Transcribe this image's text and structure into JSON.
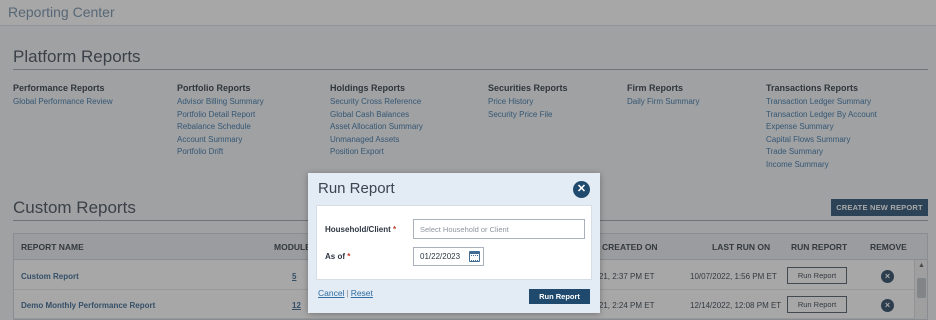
{
  "app": {
    "title": "Reporting Center"
  },
  "platform_reports": {
    "title": "Platform Reports",
    "columns": [
      {
        "heading": "Performance Reports",
        "links": [
          "Global Performance Review"
        ]
      },
      {
        "heading": "Portfolio Reports",
        "links": [
          "Advisor Billing Summary",
          "Portfolio Detail Report",
          "Rebalance Schedule",
          "Account Summary",
          "Portfolio Drift"
        ]
      },
      {
        "heading": "Holdings Reports",
        "links": [
          "Security Cross Reference",
          "Global Cash Balances",
          "Asset Allocation Summary",
          "Unmanaged Assets",
          "Position Export"
        ]
      },
      {
        "heading": "Securities Reports",
        "links": [
          "Price History",
          "Security Price File"
        ]
      },
      {
        "heading": "Firm Reports",
        "links": [
          "Daily Firm Summary"
        ]
      },
      {
        "heading": "Transactions Reports",
        "links": [
          "Transaction Ledger Summary",
          "Transaction Ledger By Account",
          "Expense Summary",
          "Capital Flows Summary",
          "Trade Summary",
          "Income Summary"
        ]
      }
    ]
  },
  "custom_reports": {
    "title": "Custom Reports",
    "create_button": "CREATE NEW REPORT",
    "headers": {
      "name": "REPORT NAME",
      "module": "MODULE",
      "created": "CREATED ON",
      "last_run": "LAST RUN ON",
      "run": "RUN REPORT",
      "remove": "REMOVE"
    },
    "rows": [
      {
        "name": "Custom Report",
        "module": "5",
        "created": "2021, 2:37 PM ET",
        "last_run": "10/07/2022, 1:56 PM ET",
        "run_label": "Run Report"
      },
      {
        "name": "Demo Monthly Performance Report",
        "module": "12",
        "created": "2021, 2:24 PM ET",
        "last_run": "12/14/2022, 12:08 PM ET",
        "run_label": "Run Report"
      }
    ]
  },
  "modal": {
    "title": "Run Report",
    "household_label": "Household/Client",
    "household_placeholder": "Select Household or Client",
    "asof_label": "As of",
    "required_mark": "*",
    "asof_value": "01/22/2023",
    "cancel": "Cancel",
    "separator": "|",
    "reset": "Reset",
    "run_button": "Run Report"
  },
  "icons": {
    "close": "close-circle-icon",
    "remove": "remove-circle-icon",
    "calendar": "calendar-icon"
  },
  "colors": {
    "primary": "#1f4a6e",
    "link": "#2f6da3",
    "required": "#c0392b"
  }
}
